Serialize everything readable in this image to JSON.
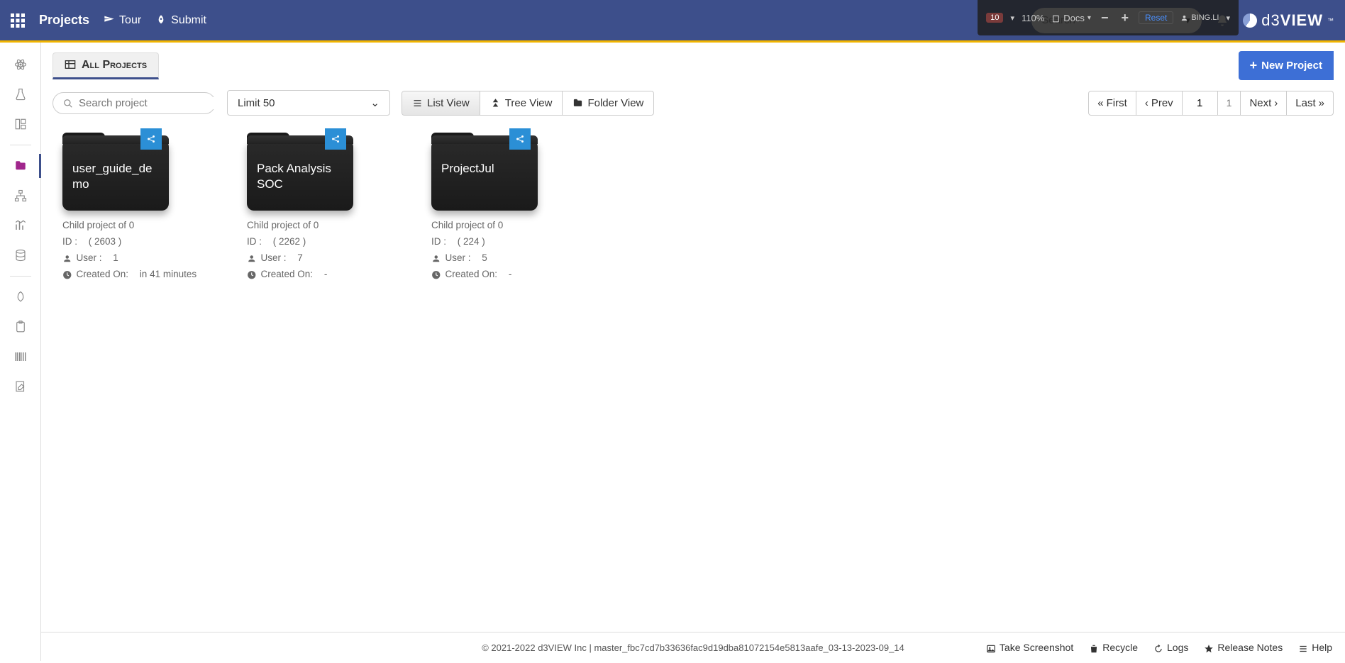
{
  "topbar": {
    "title": "Projects",
    "tour": "Tour",
    "submit": "Submit",
    "search_placeholder": "Search",
    "zoom_pct": "110%",
    "zoom_badge": "10",
    "docs": "Docs",
    "reset": "Reset",
    "user": "BING.LI",
    "logo_d3": "d3",
    "logo_view": "VIEW"
  },
  "tabs": {
    "all_projects": "All Projects",
    "new_project": "New Project"
  },
  "controls": {
    "search_placeholder": "Search project",
    "limit": "Limit 50",
    "list_view": "List View",
    "tree_view": "Tree View",
    "folder_view": "Folder View"
  },
  "pager": {
    "first": "First",
    "prev": "Prev",
    "current": "1",
    "total": "1",
    "next": "Next",
    "last": "Last"
  },
  "projects": [
    {
      "name": "user_guide_demo",
      "child": "Child project of 0",
      "id_label": "ID :",
      "id": "( 2603 )",
      "user_label": "User :",
      "user": "1",
      "created_label": "Created On:",
      "created": "in 41 minutes"
    },
    {
      "name": "Pack Analysis SOC",
      "child": "Child project of 0",
      "id_label": "ID :",
      "id": "( 2262 )",
      "user_label": "User :",
      "user": "7",
      "created_label": "Created On:",
      "created": "-"
    },
    {
      "name": "ProjectJul",
      "child": "Child project of 0",
      "id_label": "ID :",
      "id": "( 224 )",
      "user_label": "User :",
      "user": "5",
      "created_label": "Created On:",
      "created": "-"
    }
  ],
  "footer": {
    "text": "© 2021-2022 d3VIEW Inc | master_fbc7cd7b33636fac9d19dba81072154e5813aafe_03-13-2023-09_14",
    "screenshot": "Take Screenshot",
    "recycle": "Recycle",
    "logs": "Logs",
    "release": "Release Notes",
    "help": "Help"
  }
}
